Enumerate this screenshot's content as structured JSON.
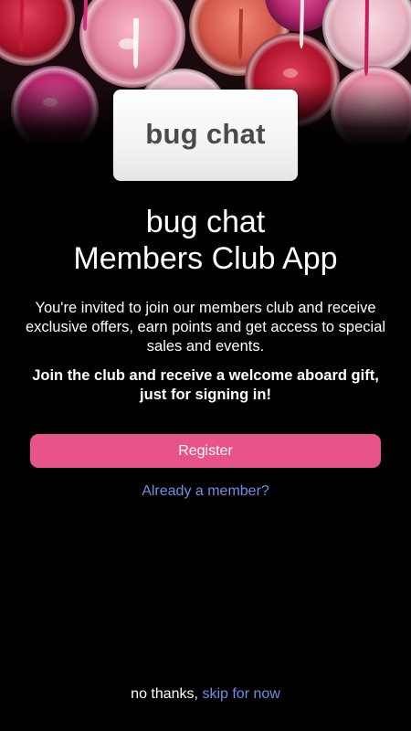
{
  "brand": {
    "logo_text": "bug chat"
  },
  "hero": {
    "image": "nail-polish-pots-photo"
  },
  "title": {
    "line1": "bug chat",
    "line2": "Members Club App"
  },
  "intro_text": "You're invited to join our members club and receive exclusive offers, earn points and get access to special sales and events.",
  "offer_text": "Join the club and receive a welcome aboard gift, just for signing in!",
  "actions": {
    "register_label": "Register",
    "already_member_label": "Already a member?"
  },
  "footer": {
    "prefix": "no thanks,",
    "skip_label": "skip for now"
  },
  "colors": {
    "background": "#000000",
    "accent": "#e8538a",
    "link": "#6f8fe6",
    "logo_text": "#4a4a4a"
  }
}
